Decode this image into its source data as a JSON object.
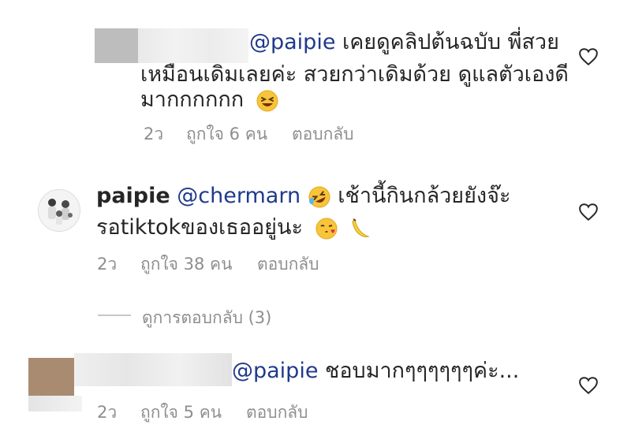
{
  "comments": [
    {
      "mention": "@paipie",
      "text_line1": " เคยดูคลิปต้นฉบับ พี่สวย",
      "text_line2": "เหมือนเดิมเลยค่ะ สวยกว่าเดิมด้วย ดูแลตัวเองดี",
      "text_line3": "มากกกกกก",
      "emoji": "grinning-squinting-face",
      "time": "2ว",
      "likes": "ถูกใจ 6 คน",
      "reply": "ตอบกลับ"
    },
    {
      "username": "paipie",
      "mention": "@chermarn",
      "text_line1": " เช้านี้กินกล้วยยังจ๊ะ",
      "text_line2": "รอtiktokของเธออยู่นะ",
      "emojis": [
        "rolling-on-floor-laughing",
        "face-blowing-kiss",
        "banana"
      ],
      "time": "2ว",
      "likes": "ถูกใจ 38 คน",
      "reply": "ตอบกลับ",
      "view_replies": "ดูการตอบกลับ (3)"
    },
    {
      "mention": "@paipie",
      "text_line1": " ชอบมากๆๆๆๆๆๆค่ะ...",
      "time": "2ว",
      "likes": "ถูกใจ 5 คน",
      "reply": "ตอบกลับ"
    }
  ],
  "icons": {
    "like": "heart-outline-icon"
  },
  "colors": {
    "mention": "#1f3a8a",
    "meta": "#8e8e8e",
    "text": "#262626"
  }
}
